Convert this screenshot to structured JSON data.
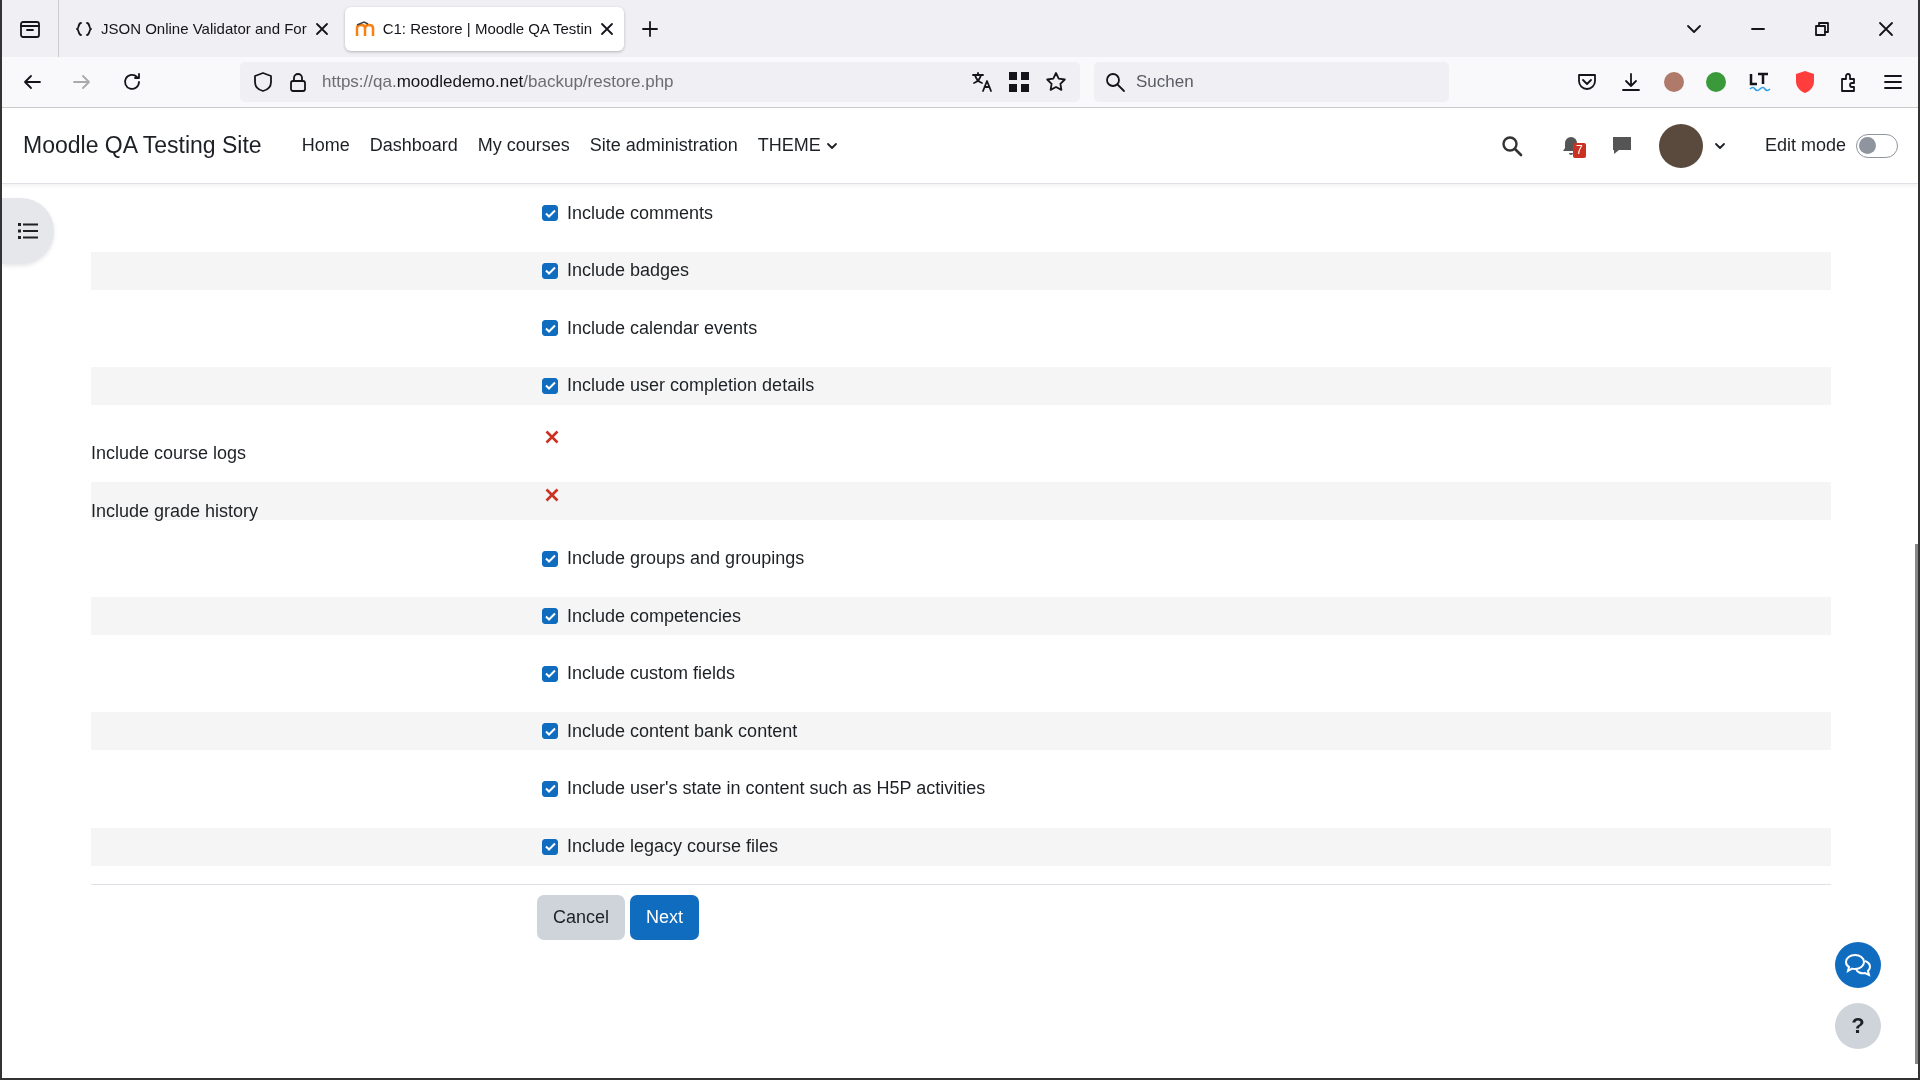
{
  "browser": {
    "tabs": [
      {
        "title": "JSON Online Validator and For",
        "selected": false
      },
      {
        "title": "C1: Restore | Moodle QA Testin",
        "selected": true
      }
    ],
    "url": {
      "scheme": "https://qa.",
      "domain": "moodledemo.net",
      "path": "/backup/restore.php"
    },
    "search": {
      "placeholder": "Suchen"
    }
  },
  "navbar": {
    "site_name": "Moodle QA Testing Site",
    "links": [
      {
        "label": "Home",
        "dropdown": false
      },
      {
        "label": "Dashboard",
        "dropdown": false
      },
      {
        "label": "My courses",
        "dropdown": false
      },
      {
        "label": "Site administration",
        "dropdown": false
      },
      {
        "label": "THEME",
        "dropdown": true
      }
    ],
    "notification_count": "7",
    "edit_mode": {
      "label": "Edit mode",
      "on": false
    }
  },
  "settings": [
    {
      "kind": "checkbox",
      "label": "Include comments",
      "checked": true
    },
    {
      "kind": "checkbox",
      "label": "Include badges",
      "checked": true
    },
    {
      "kind": "checkbox",
      "label": "Include calendar events",
      "checked": true
    },
    {
      "kind": "checkbox",
      "label": "Include user completion details",
      "checked": true
    },
    {
      "kind": "excluded",
      "label": "Include course logs"
    },
    {
      "kind": "excluded",
      "label": "Include grade history"
    },
    {
      "kind": "checkbox",
      "label": "Include groups and groupings",
      "checked": true
    },
    {
      "kind": "checkbox",
      "label": "Include competencies",
      "checked": true
    },
    {
      "kind": "checkbox",
      "label": "Include custom fields",
      "checked": true
    },
    {
      "kind": "checkbox",
      "label": "Include content bank content",
      "checked": true
    },
    {
      "kind": "checkbox",
      "label": "Include user's state in content such as H5P activities",
      "checked": true
    },
    {
      "kind": "checkbox",
      "label": "Include legacy course files",
      "checked": true
    }
  ],
  "buttons": [
    {
      "label": "Cancel",
      "kind": "secondary"
    },
    {
      "label": "Next",
      "kind": "primary"
    }
  ],
  "help_button": {
    "label": "?"
  }
}
